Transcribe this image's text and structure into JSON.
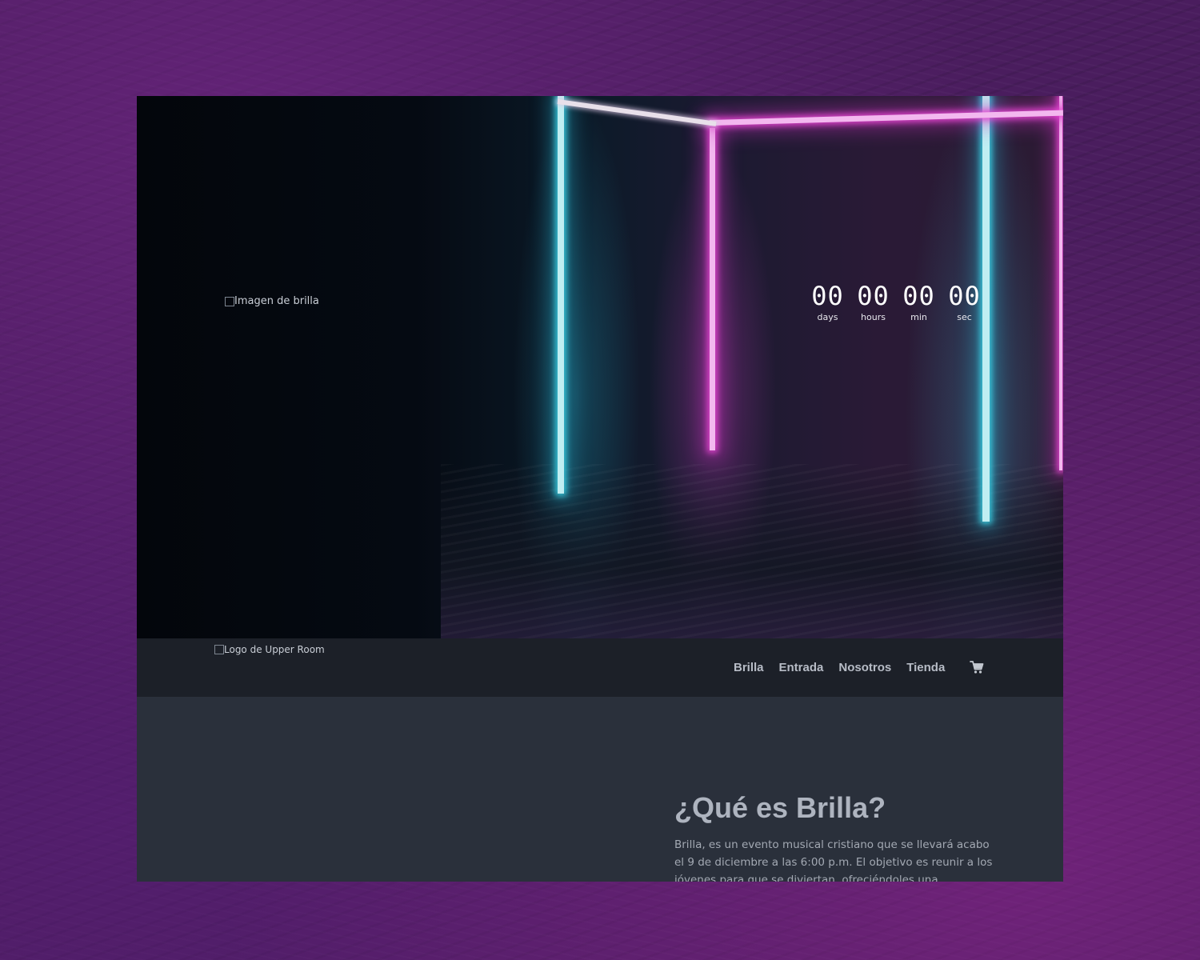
{
  "hero": {
    "image_alt": "Imagen de brilla",
    "countdown": [
      {
        "value": "00",
        "label": "days"
      },
      {
        "value": "00",
        "label": "hours"
      },
      {
        "value": "00",
        "label": "min"
      },
      {
        "value": "00",
        "label": "sec"
      }
    ]
  },
  "header": {
    "logo_alt": "Logo de Upper Room",
    "nav": [
      "Brilla",
      "Entrada",
      "Nosotros",
      "Tienda"
    ],
    "cart_icon": "shopping-cart-icon"
  },
  "content": {
    "title": "¿Qué es Brilla?",
    "text": "Brilla, es un evento musical cristiano que se llevará acabo el 9 de diciembre a las 6:00 p.m. El objetivo es reunir a los jóvenes para que se diviertan, ofreciéndoles una experiencia única. La"
  },
  "colors": {
    "page_background": "#4a1d5e",
    "header_background": "#1c2028",
    "content_background": "#2a303b",
    "neon_cyan": "#3cd2e6",
    "neon_pink": "#e646d2"
  }
}
